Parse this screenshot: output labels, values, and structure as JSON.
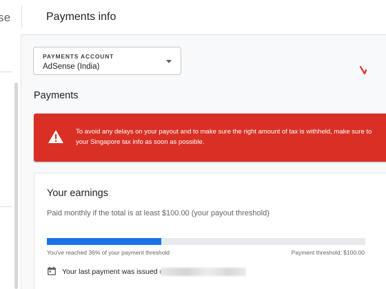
{
  "header": {
    "brand_partial": "se",
    "page_title": "Payments info"
  },
  "account": {
    "label": "PAYMENTS ACCOUNT",
    "value": "AdSense (India)"
  },
  "payments": {
    "section_title": "Payments"
  },
  "alert": {
    "line1": "To avoid any delays on your payout and to make sure the right amount of tax is withheld, make sure to",
    "line2": "your Singapore tax info as soon as possible.",
    "color": "#d93025"
  },
  "earnings": {
    "title": "Your earnings",
    "subtitle": "Paid monthly if the total is at least $100.00 (your payout threshold)",
    "progress_percent": 36,
    "progress_label": "You've reached 36% of your payment threshold",
    "threshold_label": "Payment threshold: $100.00",
    "last_payment_text": "Your last payment was issued on ."
  },
  "colors": {
    "accent_blue": "#1a73e8",
    "alert_red": "#d93025"
  },
  "icons": {
    "alert": "warning-triangle-icon",
    "calendar": "calendar-icon",
    "dropdown": "dropdown-caret-icon"
  }
}
